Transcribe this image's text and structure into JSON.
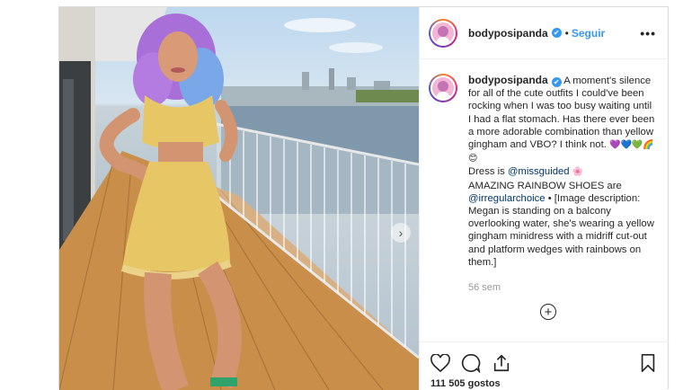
{
  "post": {
    "username": "bodyposipanda",
    "verified_mark": "✔",
    "separator": "•",
    "follow_label": "Seguir",
    "more_label": "•••",
    "caption": {
      "text_1": "A moment's silence for all of the cute outfits I could've been rocking when I was too busy waiting until I had a flat stomach. Has there ever been a more adorable combination than yellow gingham and VBO? I think not.",
      "emoji_1": "💜💙💚🌈😊",
      "dress_prefix": "Dress is ",
      "dress_mention": "@missguided",
      "emoji_2": "🌸",
      "shoes_prefix": "AMAZING RAINBOW SHOES are ",
      "shoes_mention": "@irregularchoice",
      "text_2": " • [Image description: Megan is standing on a balcony overlooking water, she's wearing a yellow gingham minidress with a midriff cut-out and platform wedges with rainbows on them.]"
    },
    "timestamp": "56 sem",
    "load_more_label": "+",
    "likes": "111 505 gostos",
    "carousel_next_label": "›"
  },
  "icons": [
    "heart-icon",
    "comment-icon",
    "share-icon",
    "bookmark-icon",
    "verified-icon",
    "chevron-right-icon",
    "plus-circle-icon"
  ],
  "colors": {
    "link": "#3897f0",
    "mention": "#003569",
    "text": "#262626",
    "muted": "#999999"
  }
}
